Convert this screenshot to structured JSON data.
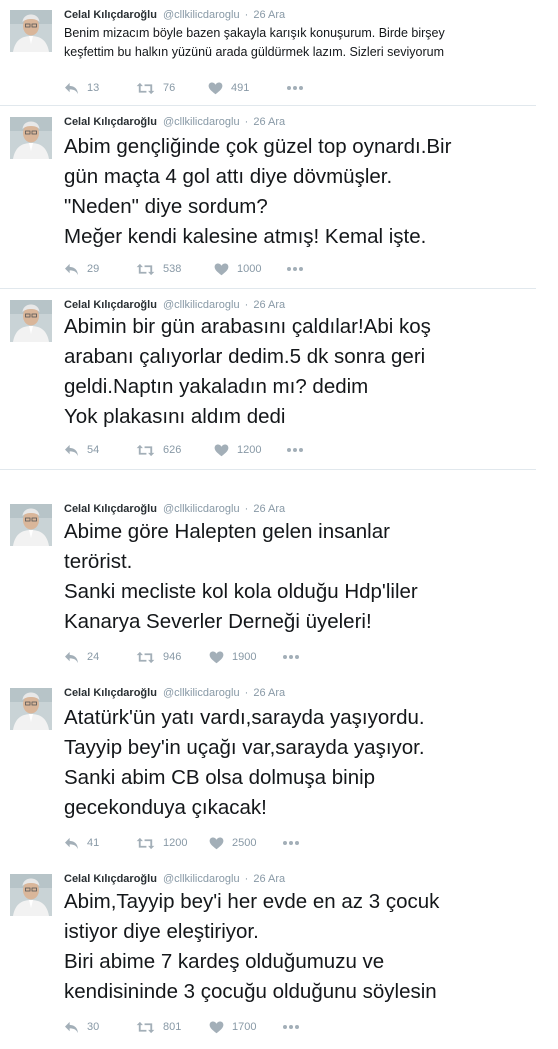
{
  "colors": {
    "name": "#292f33",
    "meta": "#8899a6",
    "text": "#14171a",
    "divider": "#e1e8ed"
  },
  "tweets": [
    {
      "name": "Celal Kılıçdaroğlu",
      "handle": "@cllkilicdaroglu",
      "date": "26 Ara",
      "lines": [
        "Benim mizacım böyle bazen şakayla karışık konuşurum. Birde birşey",
        "keşfettim bu halkın yüzünü arada güldürmek lazım.  Sizleri seviyorum"
      ],
      "replies": "13",
      "retweets": "76",
      "likes": "491"
    },
    {
      "name": "Celal Kılıçdaroğlu",
      "handle": "@cllkilicdaroglu",
      "date": "26 Ara",
      "lines": [
        "Abim gençliğinde çok güzel top oynardı.Bir",
        "gün maçta 4 gol attı diye dövmüşler.",
        "\"Neden\" diye sordum?",
        "Meğer kendi kalesine atmış! Kemal işte."
      ],
      "replies": "29",
      "retweets": "538",
      "likes": "1000"
    },
    {
      "name": "Celal Kılıçdaroğlu",
      "handle": "@cllkilicdaroglu",
      "date": "26 Ara",
      "lines": [
        "Abimin bir gün arabasını çaldılar!Abi koş",
        "arabanı çalıyorlar dedim.5 dk sonra geri",
        "geldi.Naptın yakaladın mı? dedim",
        "Yok plakasını aldım dedi"
      ],
      "replies": "54",
      "retweets": "626",
      "likes": "1200"
    },
    {
      "name": "Celal Kılıçdaroğlu",
      "handle": "@cllkilicdaroglu",
      "date": "26 Ara",
      "lines": [
        "Abime göre Halepten gelen insanlar",
        "terörist.",
        "Sanki mecliste kol kola olduğu Hdp'liler",
        "Kanarya Severler Derneği üyeleri!"
      ],
      "replies": "24",
      "retweets": "946",
      "likes": "1900"
    },
    {
      "name": "Celal Kılıçdaroğlu",
      "handle": "@cllkilicdaroglu",
      "date": "26 Ara",
      "lines": [
        "Atatürk'ün yatı vardı,sarayda yaşıyordu.",
        "Tayyip bey'in uçağı var,sarayda yaşıyor.",
        "Sanki abim CB olsa dolmuşa binip",
        "gecekonduya  çıkacak!"
      ],
      "replies": "41",
      "retweets": "1200",
      "likes": "2500"
    },
    {
      "name": "Celal Kılıçdaroğlu",
      "handle": "@cllkilicdaroglu",
      "date": "26 Ara",
      "lines": [
        "Abim,Tayyip bey'i her evde en az 3 çocuk",
        "istiyor diye eleştiriyor.",
        "Biri abime 7 kardeş olduğumuzu ve",
        "kendisininde 3 çocuğu olduğunu söylesin"
      ],
      "replies": "30",
      "retweets": "801",
      "likes": "1700"
    }
  ]
}
